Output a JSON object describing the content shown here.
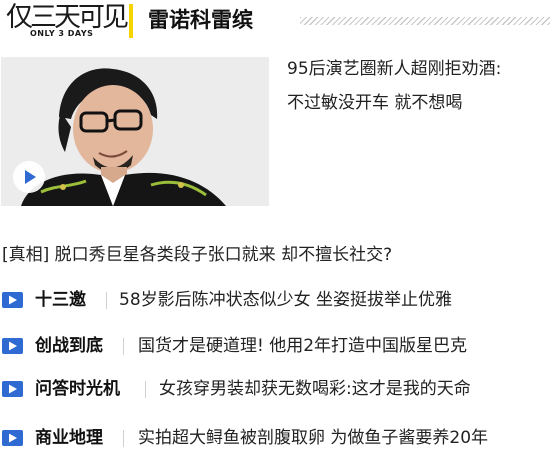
{
  "header": {
    "logo_text": "仅三天可见",
    "logo_sub": "ONLY 3 DAYS",
    "title": "雷诺科雷缤"
  },
  "feature": {
    "line1": "95后演艺圈新人超刚拒劝酒:",
    "line2": "不过敏没开车 就不想喝",
    "play_icon": "play-icon"
  },
  "headline": "[真相] 脱口秀巨星各类段子张口就来 却不擅长社交?",
  "list": [
    {
      "category": "十三邀",
      "title": "58岁影后陈冲状态似少女 坐姿挺拔举止优雅",
      "icon": "video-icon"
    },
    {
      "category": "创战到底",
      "title": "国货才是硬道理! 他用2年打造中国版星巴克",
      "icon": "video-icon"
    },
    {
      "category": "问答时光机",
      "title": "女孩穿男装却获无数喝彩:这才是我的天命",
      "icon": "video-icon"
    },
    {
      "category": "商业地理",
      "title": "实拍超大鲟鱼被剖腹取卵 为做鱼子酱要养20年",
      "icon": "video-icon"
    }
  ],
  "colors": {
    "accent_yellow": "#f5d400",
    "icon_blue": "#2e6ad1"
  }
}
